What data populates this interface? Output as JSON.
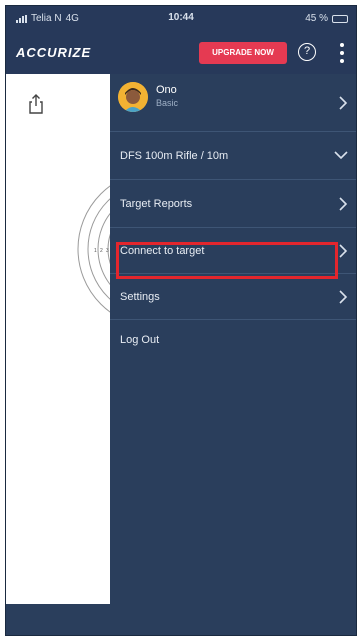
{
  "status_bar": {
    "carrier": "Telia N",
    "network": "4G",
    "time": "10:44",
    "battery_text": "45 %",
    "battery_level": 0.45
  },
  "header": {
    "logo": "ACCURIZE",
    "upgrade_label": "UPGRADE NOW",
    "help_symbol": "?"
  },
  "profile": {
    "name": "Ono",
    "subtitle": "Basic"
  },
  "menu": {
    "rifle_selector": "DFS 100m Rifle / 10m",
    "items": [
      {
        "label": "Target Reports"
      },
      {
        "label": "Connect to target"
      },
      {
        "label": "Settings"
      },
      {
        "label": "Log Out"
      }
    ]
  },
  "target": {
    "ring_labels": [
      "1",
      "2",
      "3"
    ]
  },
  "colors": {
    "background": "#2a3e5c",
    "accent": "#e53a52",
    "highlight": "#e3262d"
  },
  "icons": [
    "share-icon",
    "help-icon",
    "more-vert-icon",
    "chevron-right-icon",
    "chevron-down-icon",
    "avatar-icon"
  ]
}
